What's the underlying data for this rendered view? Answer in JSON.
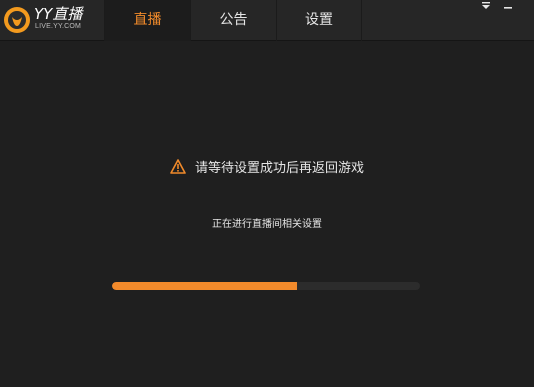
{
  "app": {
    "logo_text": "YY直播",
    "logo_subtext": "LIVE.YY.COM"
  },
  "tabs": [
    {
      "label": "直播",
      "active": true
    },
    {
      "label": "公告",
      "active": false
    },
    {
      "label": "设置",
      "active": false
    }
  ],
  "window_controls": {
    "menu_icon": "dropdown-arrow-icon",
    "minimize_icon": "minimize-icon"
  },
  "message": {
    "icon": "warning-icon",
    "text": "请等待设置成功后再返回游戏"
  },
  "status_text": "正在进行直播间相关设置",
  "progress": {
    "value": 0.6
  },
  "colors": {
    "accent": "#f08a2a",
    "background": "#1f1f1f",
    "titlebar": "#262626"
  }
}
